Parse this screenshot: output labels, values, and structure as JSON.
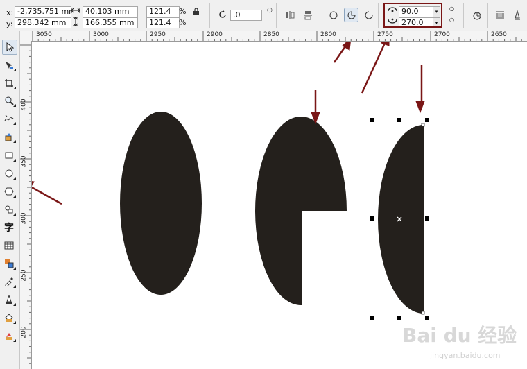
{
  "propbar": {
    "x_label": "x:",
    "x_value": "-2,735.751 mn",
    "y_label": "y:",
    "y_value": "298.342 mm",
    "width_value": "40.103 mm",
    "height_value": "166.355 mm",
    "scale_x": "121.4",
    "scale_y": "121.4",
    "percent_symbol": "%",
    "rotation_value": ".0",
    "start_angle": "90.0",
    "end_angle": "270.0",
    "pie_mode": "pressed"
  },
  "ruler_top": {
    "labels": [
      "3050",
      "3000",
      "2950",
      "2900",
      "2850",
      "2800",
      "2750",
      "2700",
      "2650"
    ]
  },
  "ruler_left": {
    "labels": [
      "400",
      "350",
      "300",
      "250",
      "200"
    ]
  },
  "watermark": {
    "main": "Bai du 经验",
    "sub": "jingyan.baidu.com"
  },
  "colors": {
    "shape_fill": "#24201c",
    "arrow": "#7a1616",
    "handle": "#000000"
  }
}
